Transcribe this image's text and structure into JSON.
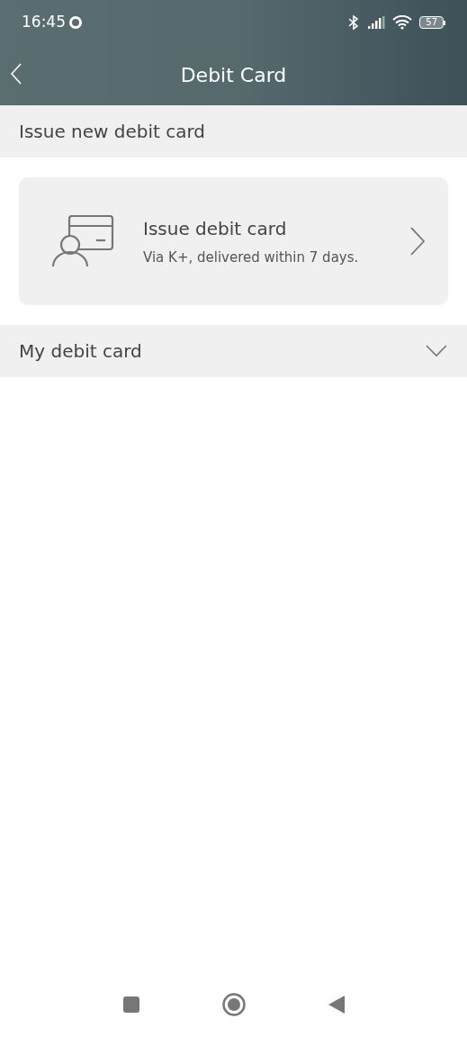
{
  "status_bar": {
    "time": "16:45",
    "battery": "57"
  },
  "header": {
    "title": "Debit Card"
  },
  "sections": [
    {
      "title": "Issue new debit card",
      "kind": "label"
    },
    {
      "title": "My debit card",
      "kind": "collapsible",
      "expanded": false
    }
  ],
  "issue_card": {
    "title": "Issue debit card",
    "subtitle": "Via K+, delivered within 7 days."
  }
}
